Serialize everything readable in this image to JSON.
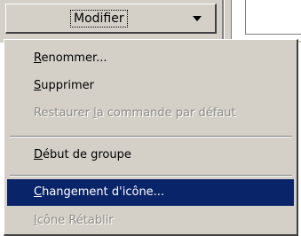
{
  "toolbar": {
    "button_label": "Modifier",
    "dropdown_icon": "chevron-down-icon"
  },
  "menu": {
    "items": [
      {
        "accel": "R",
        "rest": "enommer...",
        "state": "enabled"
      },
      {
        "accel": "S",
        "rest": "upprimer",
        "state": "enabled"
      },
      {
        "before": "Restaurer ",
        "accel": "l",
        "rest": "a commande par défaut",
        "state": "disabled"
      },
      {
        "accel": "D",
        "rest": "ébut de groupe",
        "state": "enabled"
      },
      {
        "accel": "C",
        "rest": "hangement d'icône...",
        "state": "selected"
      },
      {
        "accel": "I",
        "rest": "cône Rétablir",
        "state": "disabled"
      }
    ]
  },
  "colors": {
    "face": "#d4d0c8",
    "highlight": "#0a246a",
    "disabled_text": "#8f8b84"
  }
}
